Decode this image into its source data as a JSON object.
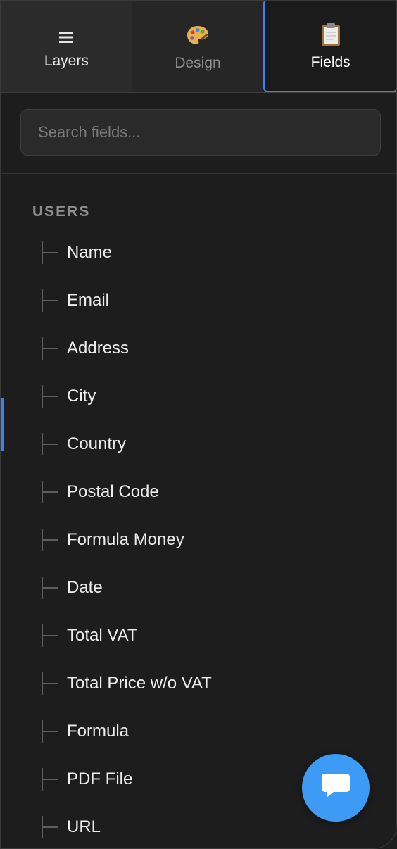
{
  "tabs": [
    {
      "label": "Layers",
      "icon": "menu-icon",
      "active": false
    },
    {
      "label": "Design",
      "icon": "palette-icon",
      "active": false
    },
    {
      "label": "Fields",
      "icon": "clipboard-icon",
      "active": true
    }
  ],
  "search": {
    "placeholder": "Search fields...",
    "value": ""
  },
  "group": {
    "label": "USERS",
    "fields": [
      "Name",
      "Email",
      "Address",
      "City",
      "Country",
      "Postal Code",
      "Formula Money",
      "Date",
      "Total VAT",
      "Total Price w/o VAT",
      "Formula",
      "PDF File",
      "URL"
    ]
  },
  "chat": {
    "icon": "chat-bubble-icon"
  },
  "colors": {
    "accent": "#3b82f6",
    "chat": "#3d9bf5",
    "background": "#1d1d1d"
  }
}
